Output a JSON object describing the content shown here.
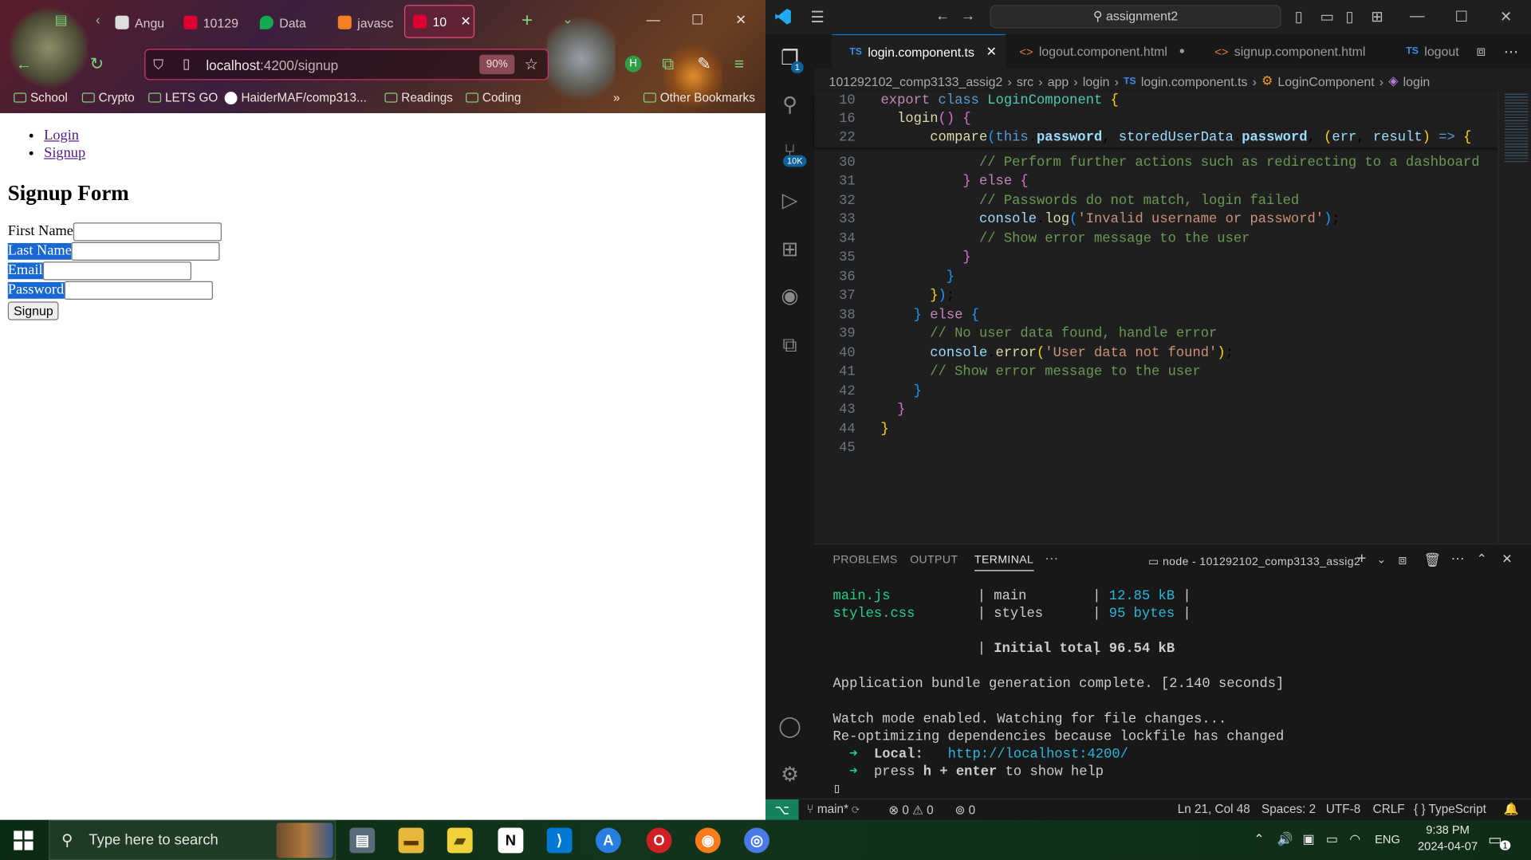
{
  "browser": {
    "tabs": [
      {
        "label": "Angul"
      },
      {
        "label": "10129"
      },
      {
        "label": "Data"
      },
      {
        "label": "javasc"
      },
      {
        "label": "10"
      }
    ],
    "url_host": "localhost",
    "url_path": ":4200/signup",
    "zoom": "90%",
    "bookmarks": [
      "School",
      "Crypto",
      "LETS GO",
      "HaiderMAF/comp313...",
      "Readings",
      "Coding",
      "Other Bookmarks"
    ]
  },
  "page": {
    "nav": [
      "Login",
      "Signup"
    ],
    "form_title": "Signup Form",
    "fields": [
      {
        "label": "First Name"
      },
      {
        "label": "Last Name"
      },
      {
        "label": "Email"
      },
      {
        "label": "Password"
      }
    ],
    "submit_label": "Signup"
  },
  "vscode": {
    "search": "assignment2",
    "tabs": [
      {
        "label": "login.component.ts",
        "type": "TS"
      },
      {
        "label": "logout.component.html",
        "type": "<>"
      },
      {
        "label": "signup.component.html",
        "type": "<>"
      },
      {
        "label": "logout",
        "type": "TS"
      }
    ],
    "breadcrumb": [
      "101292102_comp3133_assig2",
      "src",
      "app",
      "login",
      "login.component.ts",
      "LoginComponent",
      "login"
    ],
    "activity_badges": {
      "explorer": "1",
      "source_control": "10K"
    },
    "line_numbers": [
      "10",
      "16",
      "22",
      "30",
      "31",
      "32",
      "33",
      "34",
      "35",
      "36",
      "37",
      "38",
      "39",
      "40",
      "41",
      "42",
      "43",
      "44",
      "45"
    ],
    "panel": {
      "tabs": [
        "PROBLEMS",
        "OUTPUT",
        "TERMINAL"
      ],
      "terminal_name": "node - 101292102_comp3133_assig2",
      "rows": [
        {
          "file": "main.js",
          "chunk": "main",
          "size": "12.85 kB"
        },
        {
          "file": "styles.css",
          "chunk": "styles",
          "size": "95 bytes"
        }
      ],
      "total_label": "Initial total",
      "total_size": "96.54 kB",
      "bundle_msg": "Application bundle generation complete. [2.140 seconds]",
      "watch_msg": "Watch mode enabled. Watching for file changes...",
      "reopt_msg": "Re-optimizing dependencies because lockfile has changed",
      "local_label": "Local:",
      "local_url": "http://localhost:4200/",
      "help_pre": "press",
      "help_keys": "h + enter",
      "help_post": "to show help"
    },
    "status": {
      "branch": "main*",
      "errors": "0",
      "warnings": "0",
      "ports": "0",
      "position": "Ln 21, Col 48",
      "spaces": "Spaces: 2",
      "encoding": "UTF-8",
      "eol": "CRLF",
      "language": "TypeScript"
    }
  },
  "taskbar": {
    "search_placeholder": "Type here to search",
    "lang": "ENG",
    "time": "9:38 PM",
    "date": "2024-04-07",
    "notification_count": "1"
  }
}
